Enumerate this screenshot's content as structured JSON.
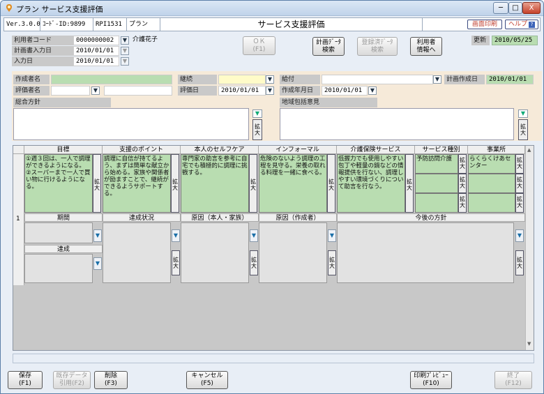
{
  "window": {
    "title": "プラン サービス支援評価",
    "min": "─",
    "max": "□",
    "close": "X"
  },
  "header": {
    "version": "Ver.3.0.0",
    "code": "ｺｰﾄﾞ-ID:9899",
    "pgm": "RPI1531",
    "mode": "プラン",
    "title": "サービス支援評価",
    "print_label": "画面印刷",
    "help_label": "ヘルプ"
  },
  "info": {
    "user_code_label": "利用者コード",
    "user_code": "0000000002",
    "user_name": "介護花子",
    "plan_date_label": "計画書入力日",
    "plan_date": "2010/01/01",
    "input_date_label": "入力日",
    "input_date": "2010/01/01",
    "ok_label": "ＯＫ\n(F1)",
    "plan_search_label": "計画ﾃﾞｰﾀ\n検索",
    "reg_search_label": "登録済ﾃﾞｰﾀ\n検索",
    "user_info_label": "利用者\n情報へ",
    "updated_label": "更新",
    "updated_date": "2010/05/25"
  },
  "form": {
    "creator_label": "作成者名",
    "creator": "",
    "continue_label": "継続",
    "continue": "",
    "benefit_label": "給付",
    "benefit": "",
    "plan_created_label": "計画作成日",
    "plan_created": "2010/01/01",
    "evaluator_label": "評価者名",
    "evaluator": "",
    "evaluator_name": "",
    "eval_date_label": "評価日",
    "eval_date": "2010/01/01",
    "created_ym_label": "作成年月日",
    "created_ym": "2010/01/01",
    "policy_label": "総合方針",
    "policy": "",
    "opinion_label": "地域包括意見",
    "opinion": "",
    "expand": "拡\n大"
  },
  "grid": {
    "headers": [
      "目標",
      "支援のポイント",
      "本人のセルフケア",
      "インフォーマル",
      "介護保険サービス",
      "サービス種別",
      "事業所"
    ],
    "row_no": "1",
    "goal": "①週３回は、一人で調理ができるようになる。\n②スーパーまで一人で買い物に行けるようになる。",
    "support": "調理に自信が持てるよう、まずは簡単な献立から始める。家族や関係者が励ますことで、継続ができるようサポートする。",
    "selfcare": "専門家の助言を参考に自宅でも積極的に調理に挑戦する。",
    "informal": "危険のないよう調理の工程を見守る。栄養の取れる料理を一緒に食べる。",
    "kaigo": "低握力でも使用しやすい包丁や軽量の鍋などの情報提供を行ない、調理しやすい環境づくりについて助言を行なう。",
    "service_type": "予防訪問介護",
    "office": "らくらくけあセンター",
    "sub_headers": [
      "期間",
      "達成状況",
      "原因（本人・家族）",
      "原因（作成者）",
      "今後の方針"
    ],
    "achieve_label": "達成",
    "expand": "拡\n大"
  },
  "footer": {
    "save": "保存\n(F1)",
    "reuse": "既存データ\n引用(F2)",
    "delete": "削除\n(F3)",
    "cancel": "キャンセル\n(F5)",
    "preview": "印刷ﾌﾟﾚﾋﾞｭｰ\n(F10)",
    "exit": "終了\n(F12)"
  },
  "colors": {
    "green": "#b9ddb1",
    "cream": "#f6ead9",
    "yellow": "#fffbc8",
    "label_gray": "#c9c9c9"
  }
}
